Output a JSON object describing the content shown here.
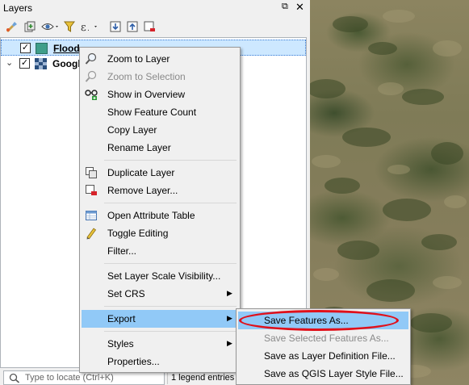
{
  "panel": {
    "title": "Layers",
    "float_glyph": "⧉",
    "close_glyph": "✕"
  },
  "toolbar": {
    "buttons": [
      {
        "name": "style-manager-icon"
      },
      {
        "name": "add-group-icon"
      },
      {
        "name": "visibility-eye-icon"
      },
      {
        "name": "filter-legend-icon"
      },
      {
        "name": "filter-expression-icon"
      },
      {
        "name": "expand-all-icon"
      },
      {
        "name": "collapse-all-icon"
      },
      {
        "name": "remove-layer-icon"
      }
    ]
  },
  "layers": [
    {
      "label": "Flood",
      "checked": "✓",
      "expander": "",
      "selected": true,
      "icon_color": "#3f9e8a"
    },
    {
      "label": "Googl",
      "checked": "✓",
      "expander": "⌄",
      "selected": false,
      "icon_color": "#2a4f7e"
    }
  ],
  "context_menu": {
    "items": [
      {
        "label": "Zoom to Layer",
        "icon": "zoom-layer-icon",
        "disabled": false
      },
      {
        "label": "Zoom to Selection",
        "icon": "zoom-selection-icon",
        "disabled": true
      },
      {
        "label": "Show in Overview",
        "icon": "overview-icon",
        "disabled": false
      },
      {
        "label": "Show Feature Count",
        "icon": "",
        "disabled": false
      },
      {
        "label": "Copy Layer",
        "icon": "",
        "disabled": false
      },
      {
        "label": "Rename Layer",
        "icon": "",
        "disabled": false
      },
      {
        "label": "Duplicate Layer",
        "icon": "duplicate-layer-icon",
        "disabled": false
      },
      {
        "label": "Remove Layer...",
        "icon": "remove-layer-icon",
        "disabled": false
      },
      {
        "label": "Open Attribute Table",
        "icon": "attribute-table-icon",
        "disabled": false
      },
      {
        "label": "Toggle Editing",
        "icon": "pencil-icon",
        "disabled": false
      },
      {
        "label": "Filter...",
        "icon": "",
        "disabled": false
      },
      {
        "label": "Set Layer Scale Visibility...",
        "icon": "",
        "disabled": false
      },
      {
        "label": "Set CRS",
        "icon": "",
        "disabled": false,
        "submenu": true
      },
      {
        "label": "Export",
        "icon": "",
        "disabled": false,
        "submenu": true,
        "highlight": true
      },
      {
        "label": "Styles",
        "icon": "",
        "disabled": false,
        "submenu": true
      },
      {
        "label": "Properties...",
        "icon": "",
        "disabled": false
      }
    ],
    "arrow_glyph": "▶"
  },
  "export_submenu": {
    "items": [
      {
        "label": "Save Features As...",
        "disabled": false,
        "highlight": true
      },
      {
        "label": "Save Selected Features As...",
        "disabled": true
      },
      {
        "label": "Save as Layer Definition File...",
        "disabled": false
      },
      {
        "label": "Save as QGIS Layer Style File...",
        "disabled": false
      }
    ]
  },
  "status": {
    "locator_placeholder": "Type to locate (Ctrl+K)",
    "legend_count": "1 legend entries"
  },
  "colors": {
    "menu_highlight": "#91c9f7",
    "annotation_circle": "#e0101a",
    "selected_row": "#cde8ff"
  }
}
